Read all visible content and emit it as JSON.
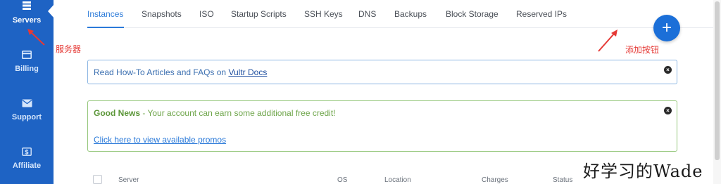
{
  "sidebar": {
    "items": [
      {
        "label": "Servers",
        "icon": "servers-icon"
      },
      {
        "label": "Billing",
        "icon": "credit-card-icon"
      },
      {
        "label": "Support",
        "icon": "envelope-icon"
      },
      {
        "label": "Affiliate",
        "icon": "dollar-icon"
      }
    ],
    "active_color": "#1e63c4"
  },
  "tabs": [
    {
      "label": "Instances"
    },
    {
      "label": "Snapshots"
    },
    {
      "label": "ISO"
    },
    {
      "label": "Startup Scripts"
    },
    {
      "label": "SSH Keys"
    },
    {
      "label": "DNS"
    },
    {
      "label": "Backups"
    },
    {
      "label": "Block Storage"
    },
    {
      "label": "Reserved IPs"
    }
  ],
  "fab": {
    "symbol": "+"
  },
  "annotations": {
    "servers": "服务器",
    "add_button": "添加按钮"
  },
  "info_banner": {
    "text_prefix": "Read How-To Articles and FAQs on",
    "link": "Vultr Docs",
    "close": "×"
  },
  "promo_banner": {
    "strong": "Good News",
    "text": " - Your account can earn some additional free credit!",
    "link": "Click here to view available promos",
    "close": "×"
  },
  "table": {
    "headers": [
      "Server",
      "OS",
      "Location",
      "Charges",
      "Status"
    ]
  },
  "watermark": "好学习的Wade"
}
